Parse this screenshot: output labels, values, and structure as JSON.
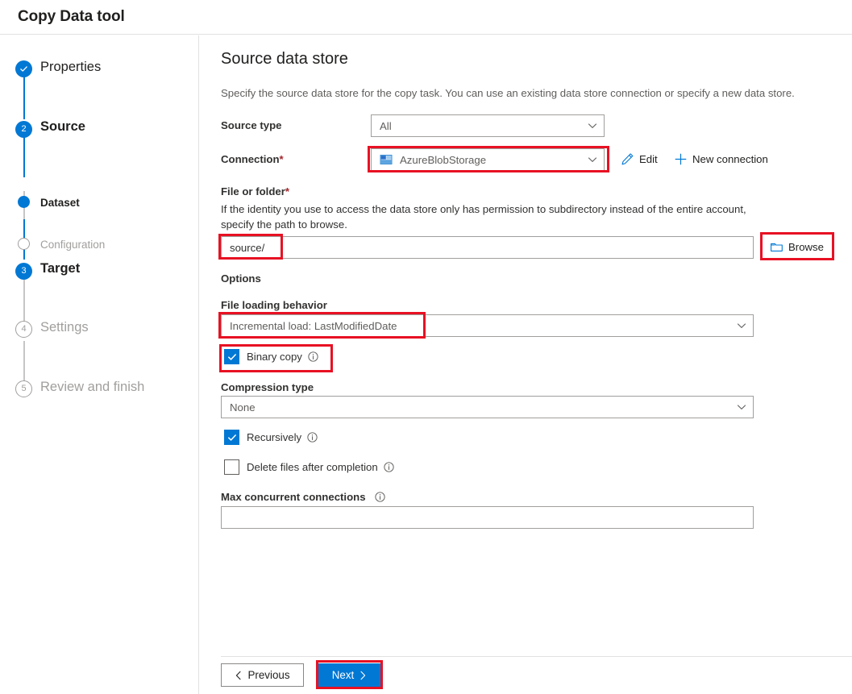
{
  "window": {
    "title": "Copy Data tool"
  },
  "sidebar": {
    "steps": [
      {
        "label": "Properties",
        "marker": "check",
        "state": "done",
        "size": "lg"
      },
      {
        "label": "Source",
        "marker": "2",
        "state": "current",
        "size": "lg"
      },
      {
        "label": "Dataset",
        "marker": "dot",
        "state": "subactive",
        "size": "sm"
      },
      {
        "label": "Configuration",
        "marker": "ring",
        "state": "todo",
        "size": "sm"
      },
      {
        "label": "Target",
        "marker": "3",
        "state": "current",
        "size": "lg"
      },
      {
        "label": "Settings",
        "marker": "4",
        "state": "todo",
        "size": "lg"
      },
      {
        "label": "Review and finish",
        "marker": "5",
        "state": "todo",
        "size": "lg"
      }
    ]
  },
  "main": {
    "page_title": "Source data store",
    "page_description": "Specify the source data store for the copy task. You can use an existing data store connection or specify a new data store.",
    "source_type": {
      "label": "Source type",
      "value": "All"
    },
    "connection": {
      "label": "Connection",
      "required_mark": "*",
      "value": "AzureBlobStorage",
      "icon": "azure-blob-storage-icon",
      "edit_label": "Edit",
      "new_connection_label": "New connection"
    },
    "file_or_folder": {
      "label": "File or folder",
      "required_mark": "*",
      "help": "If the identity you use to access the data store only has permission to subdirectory instead of the entire account, specify the path to browse.",
      "value": "source/",
      "browse_label": "Browse"
    },
    "options": {
      "heading": "Options",
      "file_loading_behavior": {
        "label": "File loading behavior",
        "value": "Incremental load: LastModifiedDate"
      },
      "binary_copy": {
        "label": "Binary copy",
        "checked": true,
        "info": "info-icon"
      },
      "compression_type": {
        "label": "Compression type",
        "value": "None"
      },
      "recursively": {
        "label": "Recursively",
        "checked": true,
        "info": "info-icon"
      },
      "delete_files": {
        "label": "Delete files after completion",
        "checked": false,
        "info": "info-icon"
      },
      "max_concurrent_connections": {
        "label": "Max concurrent connections",
        "value": "",
        "info": "info-icon"
      }
    }
  },
  "footer": {
    "previous_label": "Previous",
    "next_label": "Next"
  },
  "colors": {
    "accent": "#0078d4",
    "highlight": "#e81123",
    "required": "#a4262c",
    "muted": "#a19f9d"
  }
}
